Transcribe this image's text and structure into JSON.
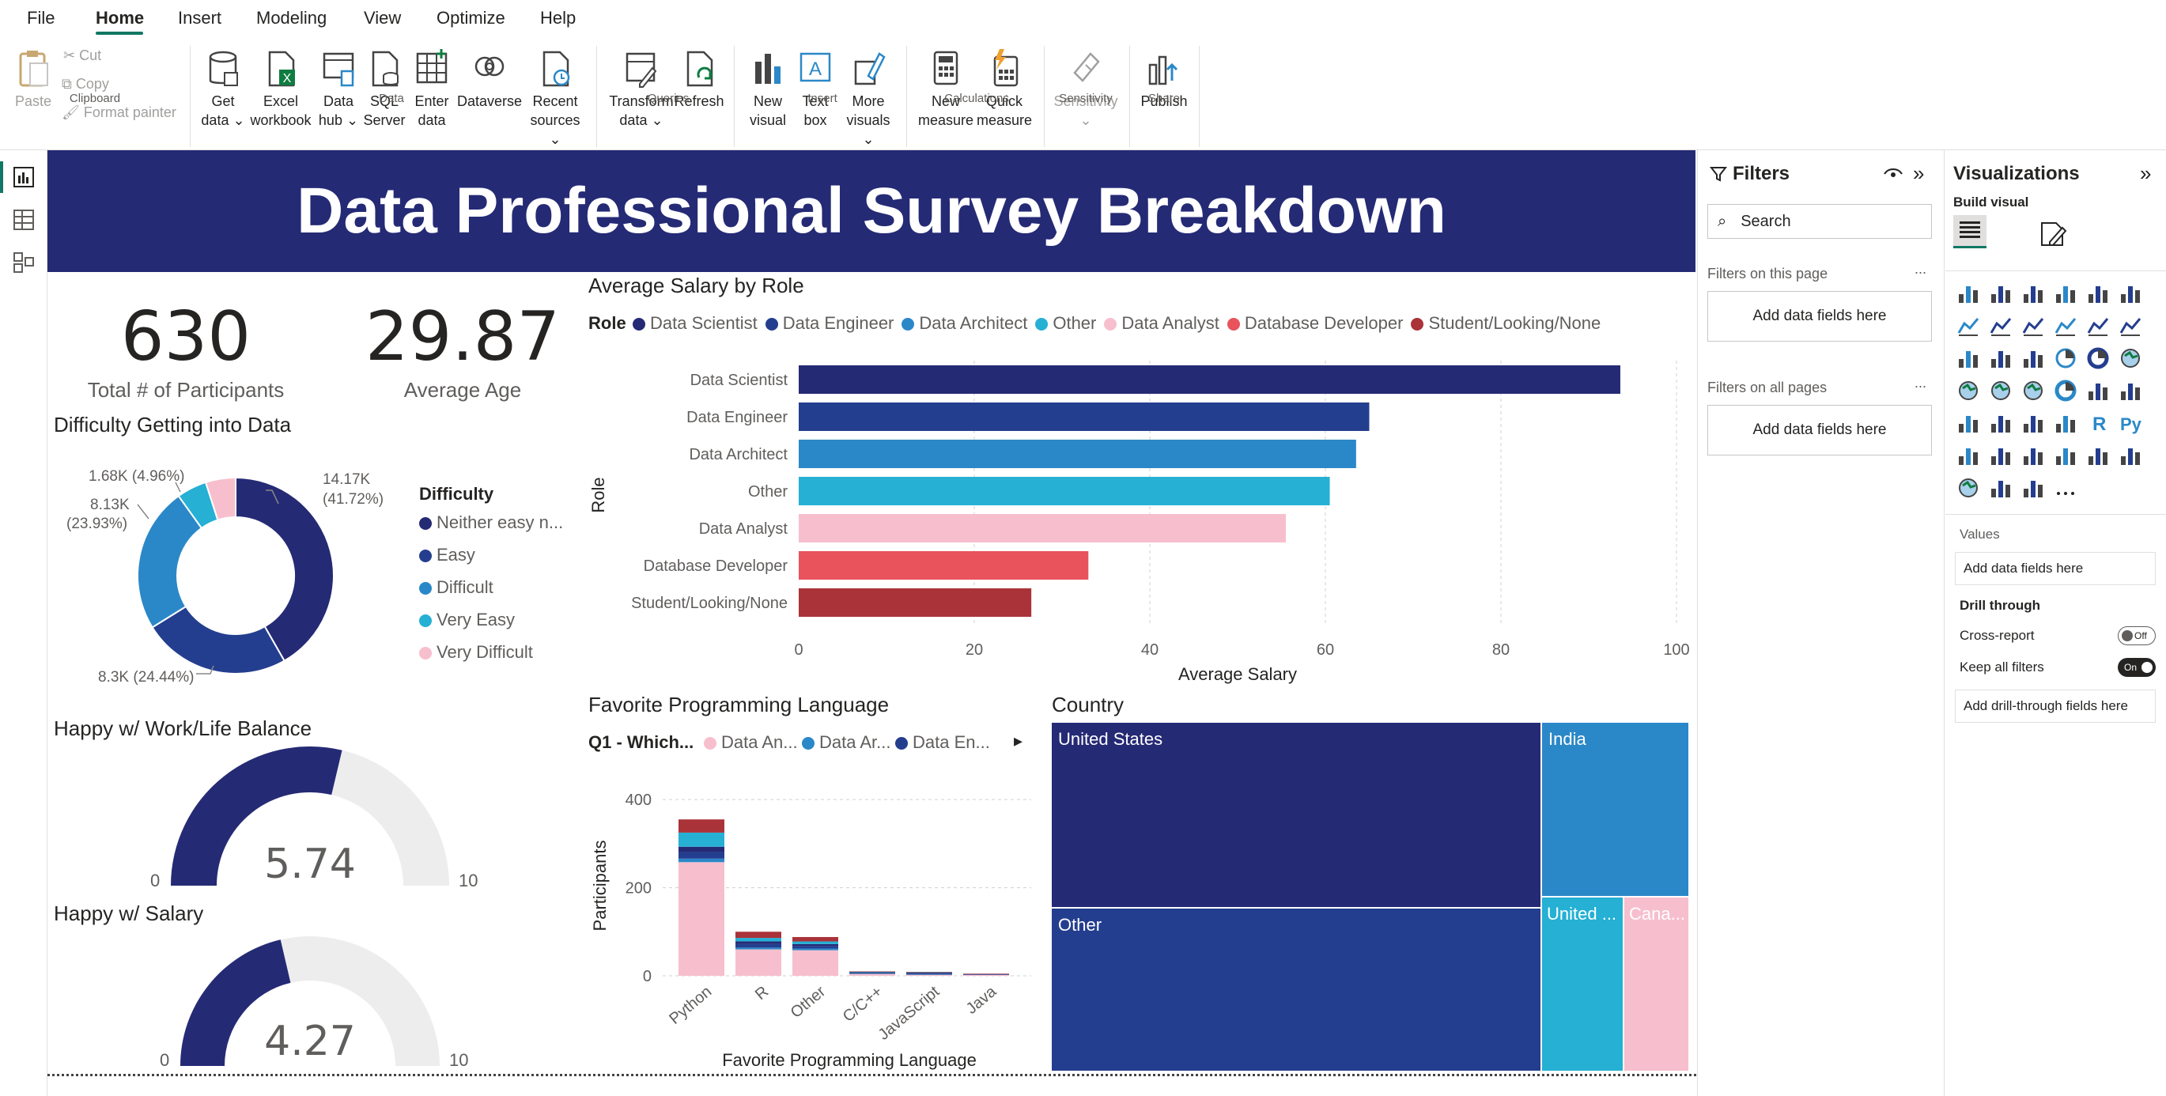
{
  "menu": {
    "file": "File",
    "home": "Home",
    "insert": "Insert",
    "modeling": "Modeling",
    "view": "View",
    "optimize": "Optimize",
    "help": "Help"
  },
  "ribbon": {
    "paste": "Paste",
    "cut": "Cut",
    "copy": "Copy",
    "format_painter": "Format painter",
    "clipboard": "Clipboard",
    "get_data": [
      "Get",
      "data"
    ],
    "excel": [
      "Excel",
      "workbook"
    ],
    "data_hub": [
      "Data",
      "hub"
    ],
    "sql": [
      "SQL",
      "Server"
    ],
    "enter_data": [
      "Enter",
      "data"
    ],
    "dataverse": "Dataverse",
    "recent": [
      "Recent",
      "sources"
    ],
    "data_group": "Data",
    "transform": [
      "Transform",
      "data"
    ],
    "refresh": "Refresh",
    "queries_group": "Queries",
    "new_visual": [
      "New",
      "visual"
    ],
    "text_box": [
      "Text",
      "box"
    ],
    "more_visuals": [
      "More",
      "visuals"
    ],
    "insert_group": "Insert",
    "new_measure": [
      "New",
      "measure"
    ],
    "quick_measure": [
      "Quick",
      "measure"
    ],
    "calc_group": "Calculations",
    "sensitivity": "Sensitivity",
    "sensitivity_group": "Sensitivity",
    "publish": "Publish",
    "share_group": "Share"
  },
  "report": {
    "title": "Data Professional Survey Breakdown",
    "participants": {
      "value": "630",
      "label": "Total # of Participants"
    },
    "age": {
      "value": "29.87",
      "label": "Average Age"
    },
    "difficulty": {
      "title": "Difficulty Getting into Data",
      "legend_title": "Difficulty",
      "labels": {
        "a": "14.17K",
        "a2": "(41.72%)",
        "b": "8.3K (24.44%)",
        "c": "8.13K",
        "c2": "(23.93%)",
        "d": "1.68K (4.96%)"
      },
      "legend": [
        "Neither easy n...",
        "Easy",
        "Difficult",
        "Very Easy",
        "Very Difficult"
      ]
    },
    "work_life": {
      "title": "Happy w/ Work/Life Balance",
      "value": "5.74",
      "min": "0",
      "max": "10",
      "fraction": 0.574
    },
    "salary_happy": {
      "title": "Happy w/ Salary",
      "value": "4.27",
      "min": "0",
      "max": "10",
      "fraction": 0.427
    },
    "salary_by_role": {
      "title": "Average Salary by Role",
      "legend_title": "Role",
      "y_axis": "Role",
      "x_axis": "Average Salary"
    },
    "languages": {
      "title": "Favorite Programming Language",
      "legend_title": "Q1 - Which...",
      "legend": [
        "Data An...",
        "Data Ar...",
        "Data En..."
      ],
      "y_axis": "Participants",
      "x_axis": "Favorite Programming Language"
    },
    "country": {
      "title": "Country",
      "cells": [
        "United States",
        "India",
        "Other",
        "United ...",
        "Cana..."
      ]
    }
  },
  "filters": {
    "title": "Filters",
    "search": "Search",
    "on_page": "Filters on this page",
    "on_all": "Filters on all pages",
    "add": "Add data fields here",
    "more": "..."
  },
  "viz": {
    "title": "Visualizations",
    "build": "Build visual",
    "values": "Values",
    "add_values": "Add data fields here",
    "drill": "Drill through",
    "cross": "Cross-report",
    "cross_state": "Off",
    "keep": "Keep all filters",
    "keep_state": "On",
    "add_drill": "Add drill-through fields here",
    "r": "R",
    "py": "Py"
  },
  "chart_data": [
    {
      "type": "bar",
      "title": "Average Salary by Role",
      "xlabel": "Average Salary",
      "ylabel": "Role",
      "categories": [
        "Data Scientist",
        "Data Engineer",
        "Data Architect",
        "Other",
        "Data Analyst",
        "Database Developer",
        "Student/Looking/None"
      ],
      "values": [
        93.6,
        65,
        63.5,
        60.5,
        55.5,
        33,
        26.5
      ],
      "colors": [
        "#252a75",
        "#243e8f",
        "#2b88c8",
        "#25b0d4",
        "#f7bfcd",
        "#e8535c",
        "#a93339"
      ],
      "xlim": [
        0,
        100
      ],
      "xticks": [
        0,
        20,
        40,
        60,
        80,
        100
      ],
      "legend": [
        "Data Scientist",
        "Data Engineer",
        "Data Architect",
        "Other",
        "Data Analyst",
        "Database Developer",
        "Student/Looking/None"
      ]
    },
    {
      "type": "bar",
      "stacked": true,
      "title": "Favorite Programming Language",
      "xlabel": "Favorite Programming Language",
      "ylabel": "Participants",
      "categories": [
        "Python",
        "R",
        "Other",
        "C/C++",
        "JavaScript",
        "Java"
      ],
      "series": [
        {
          "name": "Data Analyst",
          "color": "#f7bfcd",
          "values": [
            258,
            60,
            58,
            4,
            2,
            2
          ]
        },
        {
          "name": "Data Architect",
          "color": "#2b88c8",
          "values": [
            8,
            4,
            4,
            1,
            1,
            0
          ]
        },
        {
          "name": "Data Engineer",
          "color": "#243e8f",
          "values": [
            15,
            8,
            6,
            1,
            2,
            1
          ]
        },
        {
          "name": "Data Scientist",
          "color": "#252a75",
          "values": [
            12,
            6,
            4,
            2,
            2,
            1
          ]
        },
        {
          "name": "Other",
          "color": "#25b0d4",
          "values": [
            32,
            8,
            6,
            1,
            1,
            0
          ]
        },
        {
          "name": "Student/Looking/None",
          "color": "#a93339",
          "values": [
            30,
            14,
            10,
            1,
            1,
            1
          ]
        }
      ],
      "ylim": [
        0,
        420
      ],
      "yticks": [
        0,
        200,
        400
      ]
    },
    {
      "type": "pie",
      "donut": true,
      "title": "Difficulty Getting into Data",
      "categories": [
        "Neither easy nor difficult",
        "Easy",
        "Difficult",
        "Very Easy",
        "Very Difficult"
      ],
      "values": [
        14.17,
        8.3,
        8.13,
        1.68,
        1.68
      ],
      "percents": [
        41.72,
        24.44,
        23.93,
        4.96,
        4.95
      ],
      "colors": [
        "#252a75",
        "#243e8f",
        "#2b88c8",
        "#25b0d4",
        "#f7bfcd"
      ]
    },
    {
      "type": "treemap",
      "title": "Country",
      "categories": [
        "United States",
        "India",
        "Other",
        "United Kingdom",
        "Canada"
      ],
      "shares": [
        0.42,
        0.12,
        0.38,
        0.045,
        0.035
      ],
      "colors": [
        "#252a75",
        "#2b88c8",
        "#243e8f",
        "#25b0d4",
        "#f7bfcd"
      ]
    }
  ]
}
